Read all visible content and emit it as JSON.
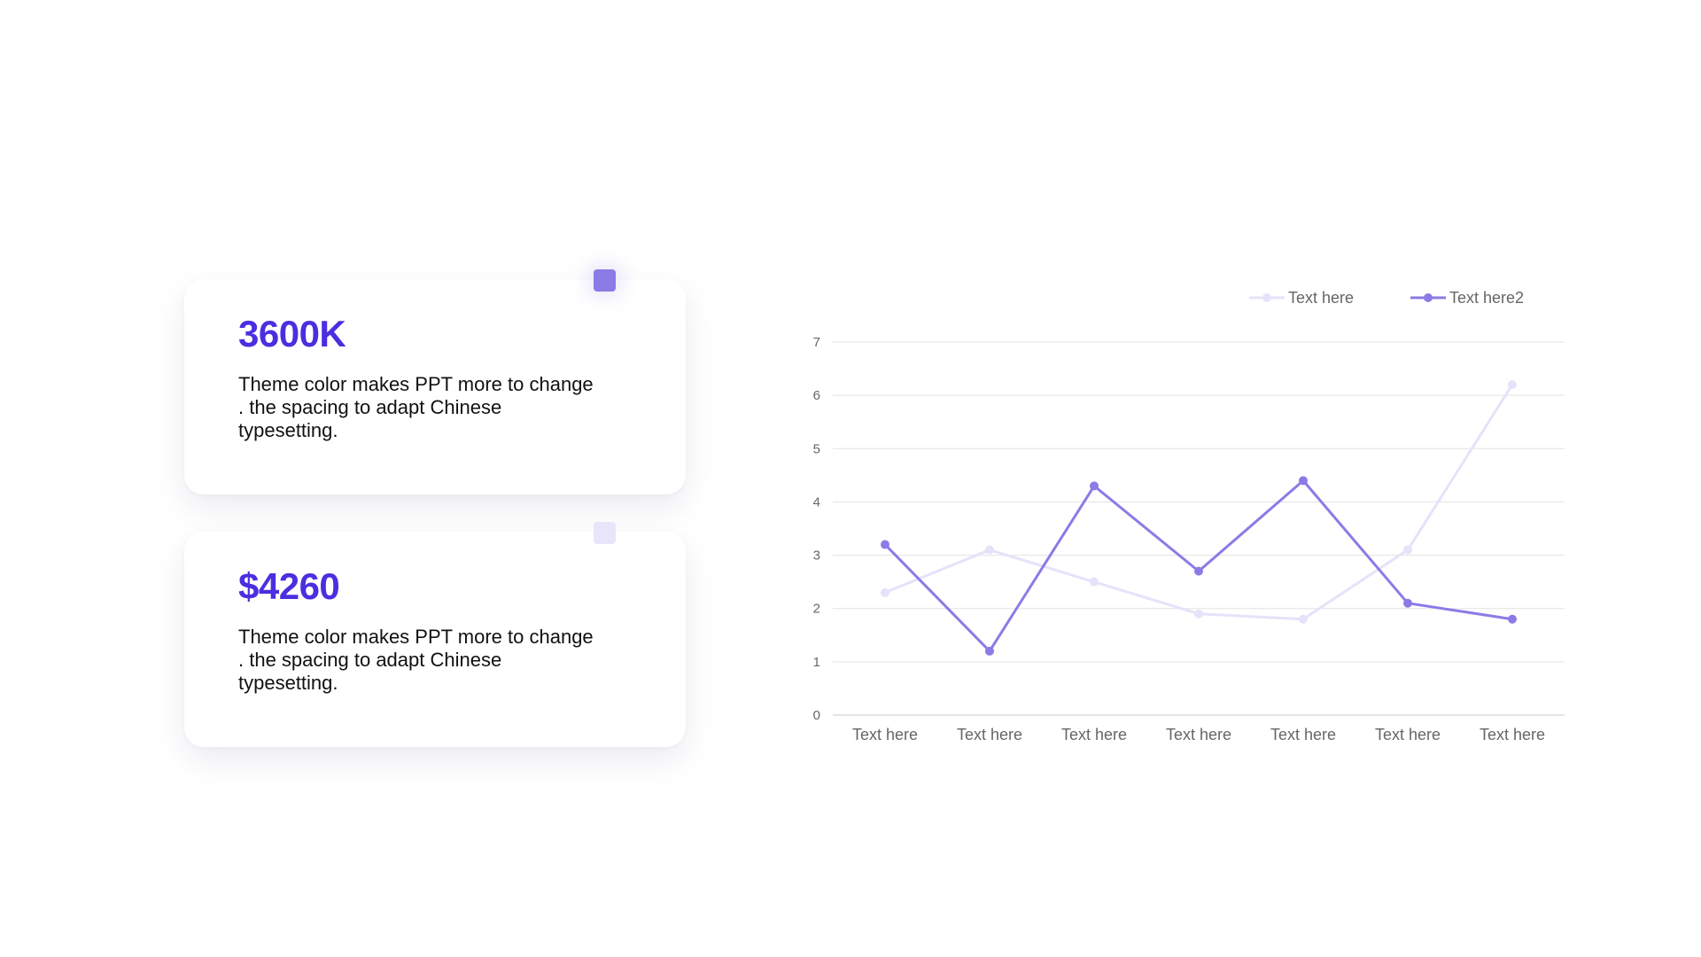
{
  "cards": [
    {
      "value": "3600K",
      "description": "Theme color makes PPT more to change . the spacing to adapt Chinese typesetting."
    },
    {
      "value": "$4260",
      "description": "Theme color makes PPT more to change . the spacing to adapt Chinese typesetting."
    }
  ],
  "colors": {
    "accent": "#4a2fe0",
    "series_dark": "#8b7be6",
    "series_light": "#e6e2fa"
  },
  "chart_data": {
    "type": "line",
    "categories": [
      "Text here",
      "Text here",
      "Text here",
      "Text here",
      "Text here",
      "Text here",
      "Text here"
    ],
    "series": [
      {
        "name": "Text here",
        "values": [
          2.3,
          3.1,
          2.5,
          1.9,
          1.8,
          3.1,
          6.2
        ],
        "color": "#e6e2fa"
      },
      {
        "name": "Text here2",
        "values": [
          3.2,
          1.2,
          4.3,
          2.7,
          4.4,
          2.1,
          1.8
        ],
        "color": "#8b7be6"
      }
    ],
    "ylim": [
      0,
      7
    ],
    "yticks": [
      0,
      1,
      2,
      3,
      4,
      5,
      6,
      7
    ],
    "grid": true,
    "legend": "top-right",
    "xlabel": "",
    "ylabel": "",
    "title": ""
  }
}
